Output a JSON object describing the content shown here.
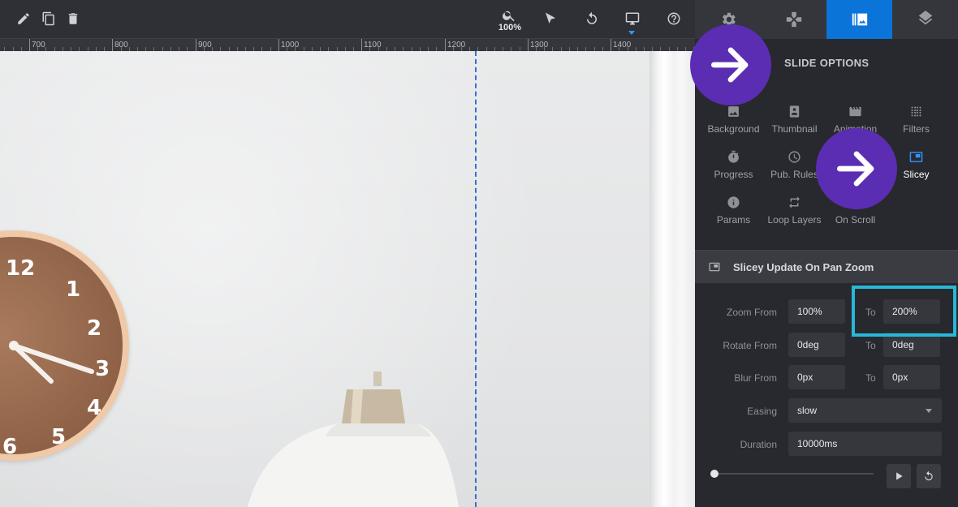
{
  "toolbar": {
    "zoom_value": "100%",
    "icons": [
      "pencil-icon",
      "copy-icon",
      "trash-icon",
      "search-zoom-icon",
      "cursor-icon",
      "undo-icon",
      "desktop-icon",
      "help-icon"
    ]
  },
  "ruler": {
    "labels": [
      "700",
      "800",
      "900",
      "1000",
      "1100",
      "1200",
      "1300",
      "1400"
    ]
  },
  "panel": {
    "tabs": [
      {
        "name": "gear-icon",
        "active": false
      },
      {
        "name": "gamepad-icon",
        "active": false
      },
      {
        "name": "slide-image-icon",
        "active": true
      },
      {
        "name": "layers-icon",
        "active": false
      }
    ],
    "section_title": "SLIDE OPTIONS",
    "options": [
      {
        "label": "Background",
        "icon": "image-icon"
      },
      {
        "label": "Thumbnail",
        "icon": "portrait-icon"
      },
      {
        "label": "Animation",
        "icon": "film-icon"
      },
      {
        "label": "Filters",
        "icon": "dots-grid-icon"
      },
      {
        "label": "Progress",
        "icon": "stopwatch-icon"
      },
      {
        "label": "Pub. Rules",
        "icon": "clock-icon"
      },
      {
        "label": "Slicey",
        "icon": "picture-in-picture-icon",
        "active": true
      },
      {
        "label": "Params",
        "icon": "info-icon"
      },
      {
        "label": "Loop Layers",
        "icon": "loop-icon"
      },
      {
        "label": "On Scroll",
        "icon": "scroll-icon"
      }
    ],
    "sub_header": "Slicey Update On Pan Zoom",
    "form": {
      "zoom_from_label": "Zoom From",
      "zoom_from": "100%",
      "zoom_to": "200%",
      "rotate_from_label": "Rotate From",
      "rotate_from": "0deg",
      "rotate_to": "0deg",
      "blur_from_label": "Blur From",
      "blur_from": "0px",
      "blur_to": "0px",
      "to_label": "To",
      "easing_label": "Easing",
      "easing": "slow",
      "duration_label": "Duration",
      "duration": "10000ms"
    },
    "timeline_progress": 0
  },
  "colors": {
    "accent": "#0b74d9",
    "highlight": "#27b8d8",
    "badge": "#5b2db3"
  }
}
